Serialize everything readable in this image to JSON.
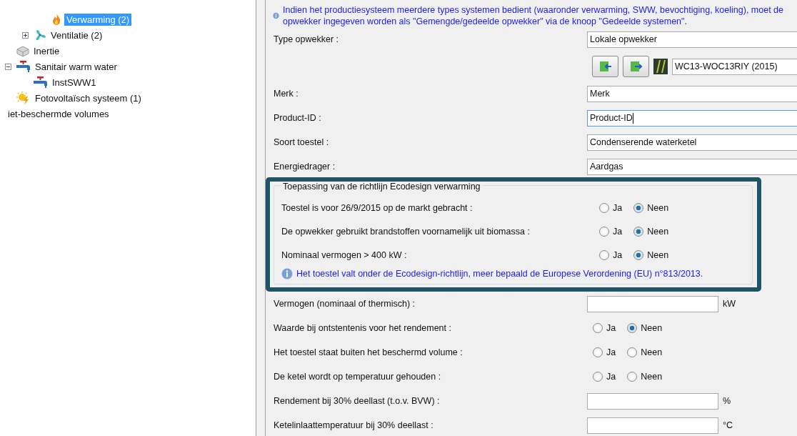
{
  "tree": [
    {
      "children": [
        {
          "children": [
            {
              "children": [
                {
                  "label": "Verwarming (2)",
                  "kind": "flame",
                  "selected": true
                }
              ]
            },
            {
              "label": "Ventilatie (2)",
              "kind": "fan",
              "selected": false,
              "expanded": false
            }
          ]
        },
        {
          "label": "Inertie",
          "kind": "block",
          "selected": false
        },
        {
          "label": "Sanitair warm water",
          "kind": "tap",
          "selected": false,
          "expanded": true,
          "children": [
            {
              "label": "InstSWW1",
              "kind": "tap",
              "selected": false
            }
          ]
        },
        {
          "label": "Fotovoltaïsch systeem (1)",
          "kind": "sun",
          "selected": false
        }
      ]
    },
    {
      "label": "iet-beschermde volumes",
      "selected": false
    }
  ],
  "notice": "Indien het productiesysteem meerdere types systemen bedient (waaronder verwarming, SWW, bevochtiging, koeling), moet de opwekker ingegeven worden als \"Gemengde/gedeelde opwekker\" via de knoop \"Gedeelde systemen\".",
  "rows": [
    {
      "kind": "select",
      "label": "Type opwekker :",
      "value": "Lokale opwekker"
    },
    {
      "kind": "catalog",
      "value": "WC13-WOC13RIY (2015)"
    },
    {
      "kind": "text",
      "label": "Merk :",
      "value": "Merk",
      "focused": false
    },
    {
      "kind": "text",
      "label": "Product-ID :",
      "value": "Product-ID",
      "focused": true
    },
    {
      "kind": "select",
      "label": "Soort toestel :",
      "value": "Condenserende waterketel"
    },
    {
      "kind": "select",
      "label": "Energiedrager :",
      "value": "Aardgas"
    }
  ],
  "ecodesign": {
    "title": "Toepassing van de richtlijn Ecodesign verwarming",
    "rows": [
      {
        "label": "Toestel is voor 26/9/2015 op de markt gebracht :",
        "options": [
          {
            "label": "Ja",
            "selected": false
          },
          {
            "label": "Neen",
            "selected": true
          }
        ]
      },
      {
        "label": "De opwekker gebruikt brandstoffen voornamelijk uit biomassa :",
        "options": [
          {
            "label": "Ja",
            "selected": false
          },
          {
            "label": "Neen",
            "selected": true
          }
        ]
      },
      {
        "label": "Nominaal vermogen > 400 kW :",
        "options": [
          {
            "label": "Ja",
            "selected": false
          },
          {
            "label": "Neen",
            "selected": true
          }
        ]
      }
    ],
    "notice": "Het toestel valt onder de Ecodesign-richtlijn, meer bepaald de Europese Verordening (EU) n°813/2013."
  },
  "rows_after": [
    {
      "kind": "number",
      "label": "Vermogen (nominaal of thermisch) :",
      "unit": "kW"
    },
    {
      "kind": "radio",
      "label": "Waarde bij ontstentenis voor het rendement :",
      "options": [
        {
          "label": "Ja",
          "selected": false
        },
        {
          "label": "Neen",
          "selected": true
        }
      ]
    },
    {
      "kind": "radio",
      "label": "Het toestel staat buiten het beschermd volume :",
      "options": [
        {
          "label": "Ja",
          "selected": false
        },
        {
          "label": "Neen",
          "selected": false
        }
      ]
    },
    {
      "kind": "radio",
      "label": "De ketel wordt op temperatuur gehouden :",
      "options": [
        {
          "label": "Ja",
          "selected": false
        },
        {
          "label": "Neen",
          "selected": false
        }
      ]
    },
    {
      "kind": "number",
      "label": "Rendement bij 30% deellast (t.o.v. BVW) :",
      "unit": "%"
    },
    {
      "kind": "number",
      "label": "Ketelinlaattemperatuur bij 30% deellast :",
      "unit": "°C"
    }
  ]
}
